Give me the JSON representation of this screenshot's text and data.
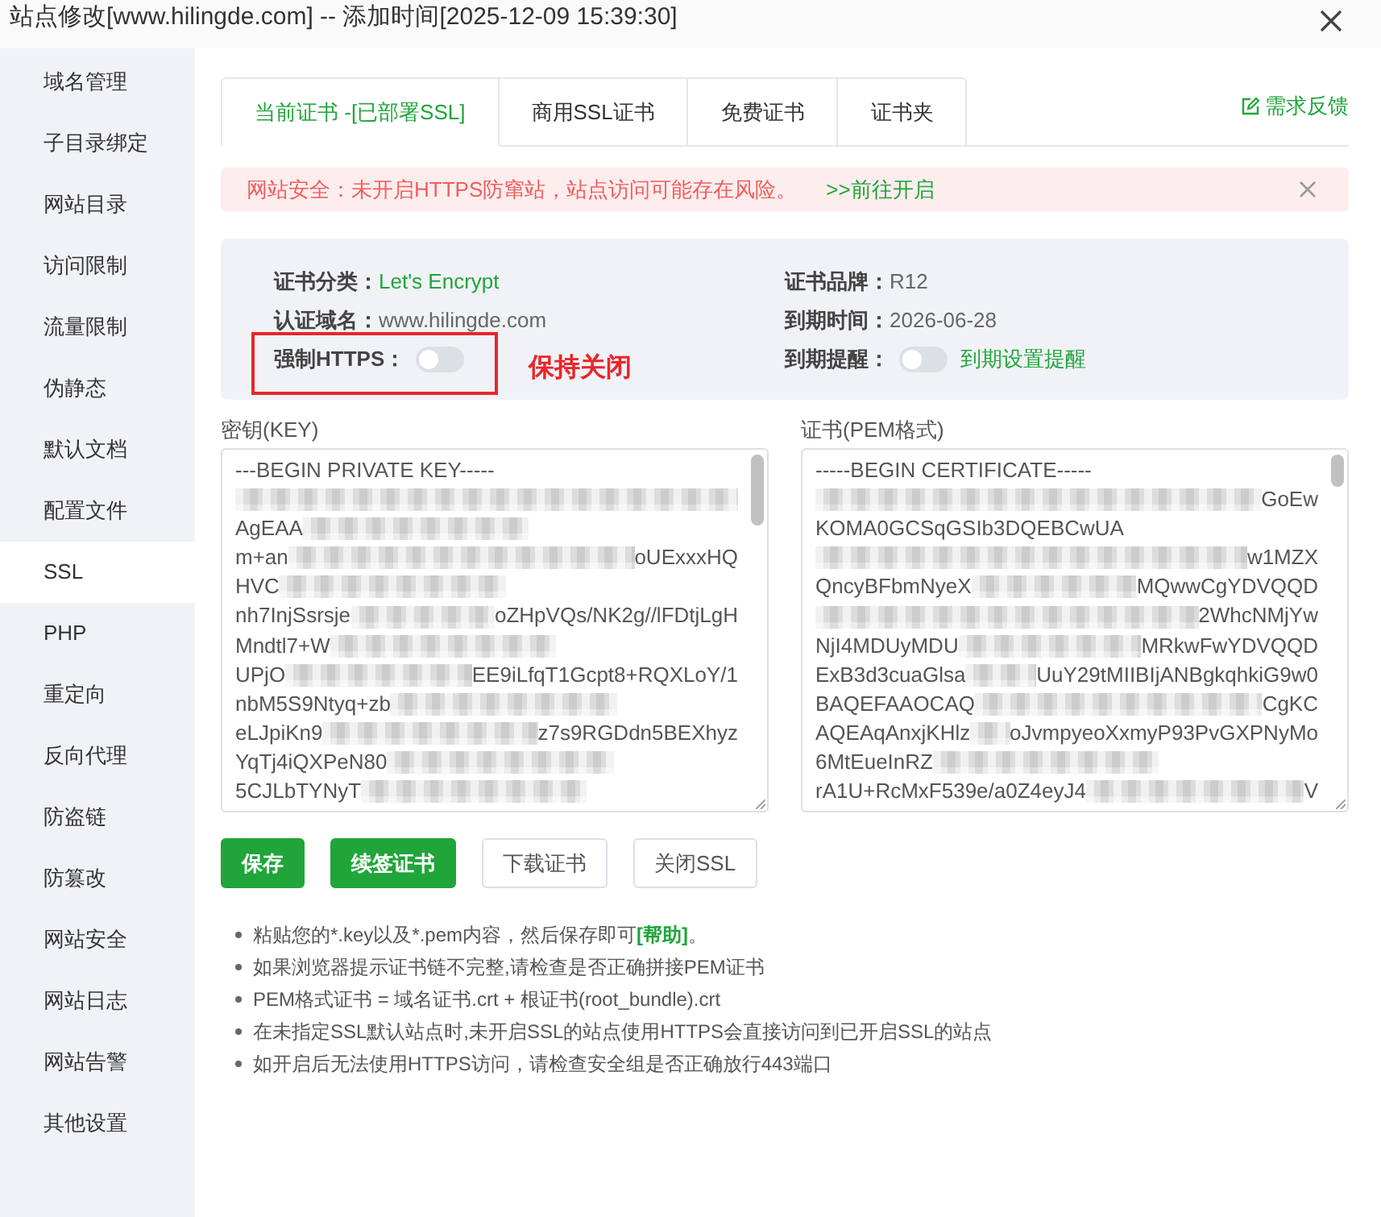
{
  "window": {
    "title": "站点修改[www.hilingde.com] -- 添加时间[2025-12-09 15:39:30]"
  },
  "sidebar": {
    "items": [
      {
        "label": "域名管理",
        "selected": false
      },
      {
        "label": "子目录绑定",
        "selected": false
      },
      {
        "label": "网站目录",
        "selected": false
      },
      {
        "label": "访问限制",
        "selected": false
      },
      {
        "label": "流量限制",
        "selected": false
      },
      {
        "label": "伪静态",
        "selected": false
      },
      {
        "label": "默认文档",
        "selected": false
      },
      {
        "label": "配置文件",
        "selected": false
      },
      {
        "label": "SSL",
        "selected": true
      },
      {
        "label": "PHP",
        "selected": false
      },
      {
        "label": "重定向",
        "selected": false
      },
      {
        "label": "反向代理",
        "selected": false
      },
      {
        "label": "防盗链",
        "selected": false
      },
      {
        "label": "防篡改",
        "selected": false
      },
      {
        "label": "网站安全",
        "selected": false
      },
      {
        "label": "网站日志",
        "selected": false
      },
      {
        "label": "网站告警",
        "selected": false
      },
      {
        "label": "其他设置",
        "selected": false
      }
    ]
  },
  "tabs": [
    {
      "label": "当前证书 -[已部署SSL]",
      "selected": true
    },
    {
      "label": "商用SSL证书",
      "selected": false
    },
    {
      "label": "免费证书",
      "selected": false
    },
    {
      "label": "证书夹",
      "selected": false
    }
  ],
  "feedback_link": {
    "label": "需求反馈"
  },
  "alert": {
    "message": "网站安全：未开启HTTPS防窜站，站点访问可能存在风险。",
    "action": ">>前往开启"
  },
  "cert_info": {
    "fields": [
      {
        "kind": "text",
        "label": "证书分类：",
        "value": "Let's Encrypt",
        "highlight": true
      },
      {
        "kind": "text",
        "label": "证书品牌：",
        "value": "R12",
        "highlight": false
      },
      {
        "kind": "text",
        "label": "认证域名：",
        "value": "www.hilingde.com",
        "highlight": false
      },
      {
        "kind": "text",
        "label": "到期时间：",
        "value": "2026-06-28",
        "highlight": false
      },
      {
        "kind": "toggle",
        "label": "强制HTTPS：",
        "on": false,
        "annotation": "保持关闭"
      },
      {
        "kind": "toggle",
        "label": "到期提醒：",
        "on": false,
        "link": "到期设置提醒"
      }
    ]
  },
  "key_field": {
    "label": "密钥(KEY)",
    "lines": [
      [
        {
          "kind": "text",
          "text": "---BEGIN PRIVATE KEY-----"
        }
      ],
      [
        {
          "kind": "redacted"
        }
      ],
      [
        {
          "kind": "text",
          "text": "AgEAA"
        },
        {
          "kind": "redacted"
        }
      ],
      [
        {
          "kind": "text",
          "text": "m+an"
        },
        {
          "kind": "redacted"
        },
        {
          "kind": "text",
          "text": "oUExxxHQ"
        }
      ],
      [
        {
          "kind": "text",
          "text": "HVC"
        },
        {
          "kind": "redacted"
        }
      ],
      [
        {
          "kind": "text",
          "text": "nh7InjSsrsje"
        },
        {
          "kind": "redacted"
        },
        {
          "kind": "text",
          "text": "oZHpVQs/NK2g//lFDtjLgH"
        }
      ],
      [
        {
          "kind": "text",
          "text": "Mndtl7+W"
        },
        {
          "kind": "redacted"
        }
      ],
      [
        {
          "kind": "text",
          "text": "UPjO"
        },
        {
          "kind": "redacted"
        },
        {
          "kind": "text",
          "text": "EE9iLfqT1Gcpt8+RQXLoY/1"
        }
      ],
      [
        {
          "kind": "text",
          "text": "nbM5S9Ntyq+zb"
        },
        {
          "kind": "redacted"
        }
      ],
      [
        {
          "kind": "text",
          "text": "eLJpiKn9"
        },
        {
          "kind": "redacted"
        },
        {
          "kind": "text",
          "text": "z7s9RGDdn5BEXhyz"
        }
      ],
      [
        {
          "kind": "text",
          "text": "YqTj4iQXPeN80"
        },
        {
          "kind": "redacted"
        }
      ],
      [
        {
          "kind": "text",
          "text": "5CJLbTYNyT"
        },
        {
          "kind": "redacted"
        }
      ]
    ]
  },
  "cert_field": {
    "label": "证书(PEM格式)",
    "lines": [
      [
        {
          "kind": "text",
          "text": "-----BEGIN CERTIFICATE-----"
        }
      ],
      [
        {
          "kind": "redacted"
        },
        {
          "kind": "text",
          "text": "GoEw"
        }
      ],
      [
        {
          "kind": "text",
          "text": "KOMA0GCSqGSIb3DQEBCwUA"
        }
      ],
      [
        {
          "kind": "redacted"
        },
        {
          "kind": "text",
          "text": "w1MZX"
        }
      ],
      [
        {
          "kind": "text",
          "text": "QncyBFbmNyeX"
        },
        {
          "kind": "redacted"
        },
        {
          "kind": "text",
          "text": "MQwwCgYDVQQD"
        }
      ],
      [
        {
          "kind": "redacted"
        },
        {
          "kind": "text",
          "text": "2WhcNMjYw"
        }
      ],
      [
        {
          "kind": "text",
          "text": "NjI4MDUyMDU"
        },
        {
          "kind": "redacted"
        },
        {
          "kind": "text",
          "text": "MRkwFwYDVQQD"
        }
      ],
      [
        {
          "kind": "text",
          "text": "ExB3d3cuaGlsa"
        },
        {
          "kind": "redacted"
        },
        {
          "kind": "text",
          "text": "UuY29tMIIBIjANBgkqhkiG9w0"
        }
      ],
      [
        {
          "kind": "text",
          "text": "BAQEFAAOCAQ"
        },
        {
          "kind": "redacted"
        },
        {
          "kind": "text",
          "text": "CgKC"
        }
      ],
      [
        {
          "kind": "text",
          "text": "AQEAqAnxjKHlz"
        },
        {
          "kind": "redacted"
        },
        {
          "kind": "text",
          "text": "oJvmpyeoXxmyP93PvGXPNyMo"
        }
      ],
      [
        {
          "kind": "text",
          "text": "6MtEueInRZ"
        },
        {
          "kind": "redacted"
        }
      ],
      [
        {
          "kind": "text",
          "text": "rA1U+RcMxF539e/a0Z4eyJ4"
        },
        {
          "kind": "redacted"
        },
        {
          "kind": "text",
          "text": "V"
        }
      ]
    ]
  },
  "buttons": [
    {
      "label": "保存",
      "kind": "primary"
    },
    {
      "label": "续签证书",
      "kind": "primary"
    },
    {
      "label": "下载证书",
      "kind": "outline"
    },
    {
      "label": "关闭SSL",
      "kind": "outline"
    }
  ],
  "notes": [
    {
      "text": "粘贴您的*.key以及*.pem内容，然后保存即可",
      "link": "[帮助]",
      "tail": "。"
    },
    {
      "text": "如果浏览器提示证书链不完整,请检查是否正确拼接PEM证书"
    },
    {
      "text": "PEM格式证书 = 域名证书.crt + 根证书(root_bundle).crt"
    },
    {
      "text": "在未指定SSL默认站点时,未开启SSL的站点使用HTTPS会直接访问到已开启SSL的站点"
    },
    {
      "text": "如开启后无法使用HTTPS访问，请检查安全组是否正确放行443端口"
    }
  ]
}
